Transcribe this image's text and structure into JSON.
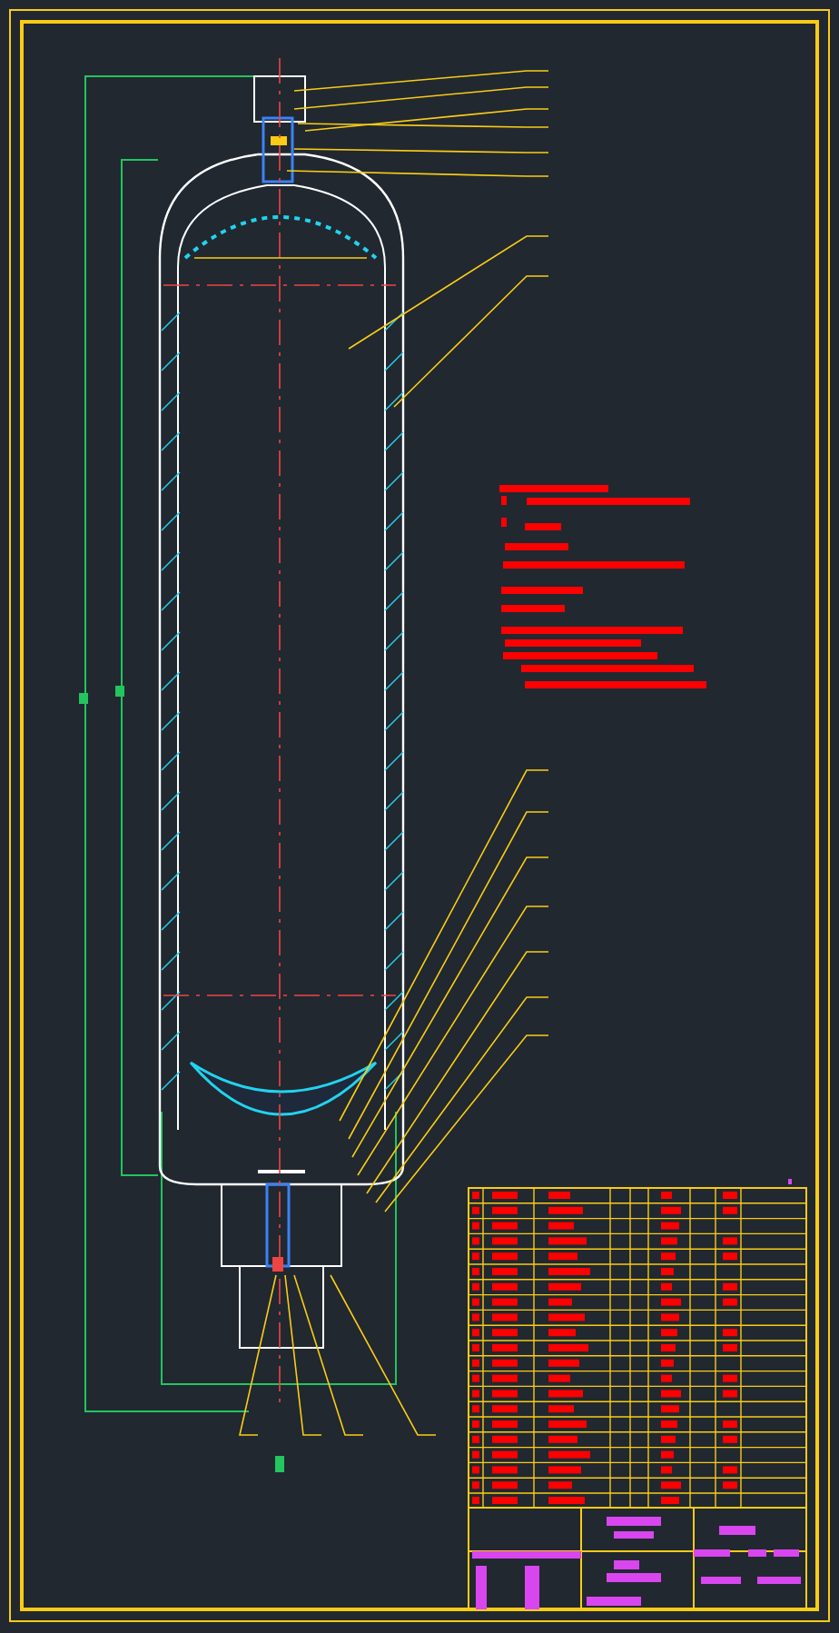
{
  "sheet": {
    "kind": "cad-drawing"
  },
  "title_block": {
    "kind": "parts-table"
  }
}
